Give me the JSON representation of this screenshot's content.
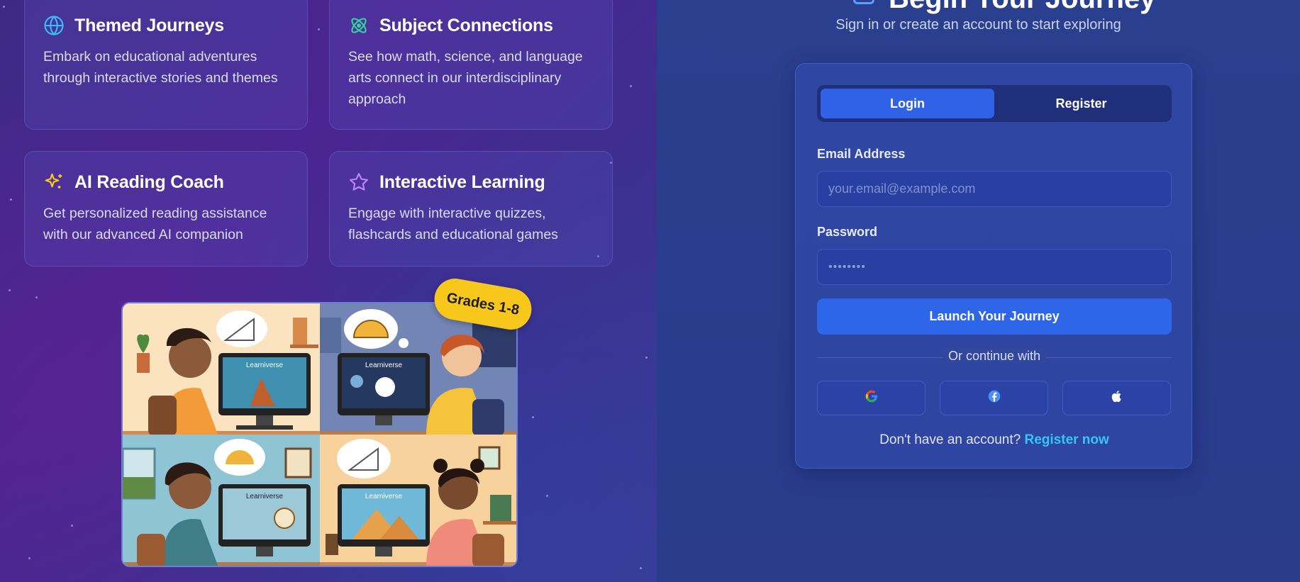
{
  "features": [
    {
      "title": "Themed Journeys",
      "desc": "Embark on educational adventures through interactive stories and themes",
      "icon": "globe-icon"
    },
    {
      "title": "Subject Connections",
      "desc": "See how math, science, and language arts connect in our interdisciplinary approach",
      "icon": "atom-icon"
    },
    {
      "title": "AI Reading Coach",
      "desc": "Get personalized reading assistance with our advanced AI companion",
      "icon": "sparkles-icon"
    },
    {
      "title": "Interactive Learning",
      "desc": "Engage with interactive quizzes, flashcards and educational games",
      "icon": "star-icon"
    }
  ],
  "illustration": {
    "badge": "Grades 1-8",
    "screen_label": "Learniverse"
  },
  "auth": {
    "heading": "Begin Your Journey",
    "subtitle": "Sign in or create an account to start exploring",
    "tabs": {
      "login": "Login",
      "register": "Register"
    },
    "email_label": "Email Address",
    "email_placeholder": "your.email@example.com",
    "password_label": "Password",
    "password_value": "••••••••",
    "submit": "Launch Your Journey",
    "divider": "Or continue with",
    "social": [
      "google-icon",
      "facebook-icon",
      "apple-icon"
    ],
    "footer_text": "Don't have an account?",
    "footer_link": "Register now"
  },
  "colors": {
    "accent": "#2e66ea",
    "link": "#35c6f4",
    "badge": "#f7c81b"
  }
}
